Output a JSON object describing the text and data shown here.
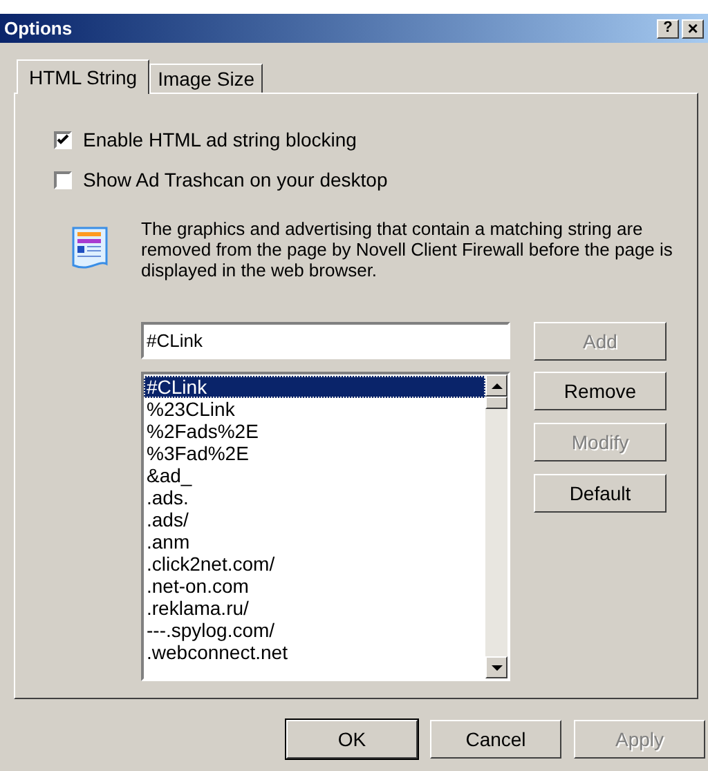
{
  "window": {
    "title": "Options",
    "help_button": "?",
    "close_button": "×"
  },
  "tabs": [
    {
      "label": "HTML String",
      "selected": true
    },
    {
      "label": "Image Size",
      "selected": false
    }
  ],
  "options": [
    {
      "label": "Enable HTML ad string blocking",
      "checked": true
    },
    {
      "label": "Show Ad Trashcan on your desktop",
      "checked": false
    }
  ],
  "description": "The graphics and advertising that contain a matching string are removed from the page by Novell Client Firewall before the page is displayed in the web browser.",
  "string_field": {
    "value": "#CLink"
  },
  "strings": [
    {
      "text": "#CLink",
      "selected": true
    },
    {
      "text": "%23CLink",
      "selected": false
    },
    {
      "text": "%2Fads%2E",
      "selected": false
    },
    {
      "text": "%3Fad%2E",
      "selected": false
    },
    {
      "text": "&ad_",
      "selected": false
    },
    {
      "text": ".ads.",
      "selected": false
    },
    {
      "text": ".ads/",
      "selected": false
    },
    {
      "text": ".anm",
      "selected": false
    },
    {
      "text": ".click2net.com/",
      "selected": false
    },
    {
      "text": ".net-on.com",
      "selected": false
    },
    {
      "text": ".reklama.ru/",
      "selected": false
    },
    {
      "text": "---.spylog.com/",
      "selected": false
    },
    {
      "text": ".webconnect.net",
      "selected": false
    }
  ],
  "side_buttons": [
    {
      "label": "Add",
      "disabled": true
    },
    {
      "label": "Remove",
      "disabled": false
    },
    {
      "label": "Modify",
      "disabled": true
    },
    {
      "label": "Default",
      "disabled": false
    }
  ],
  "footer_buttons": [
    {
      "label": "OK",
      "disabled": false,
      "default": true
    },
    {
      "label": "Cancel",
      "disabled": false,
      "default": false
    },
    {
      "label": "Apply",
      "disabled": true,
      "default": false
    }
  ]
}
